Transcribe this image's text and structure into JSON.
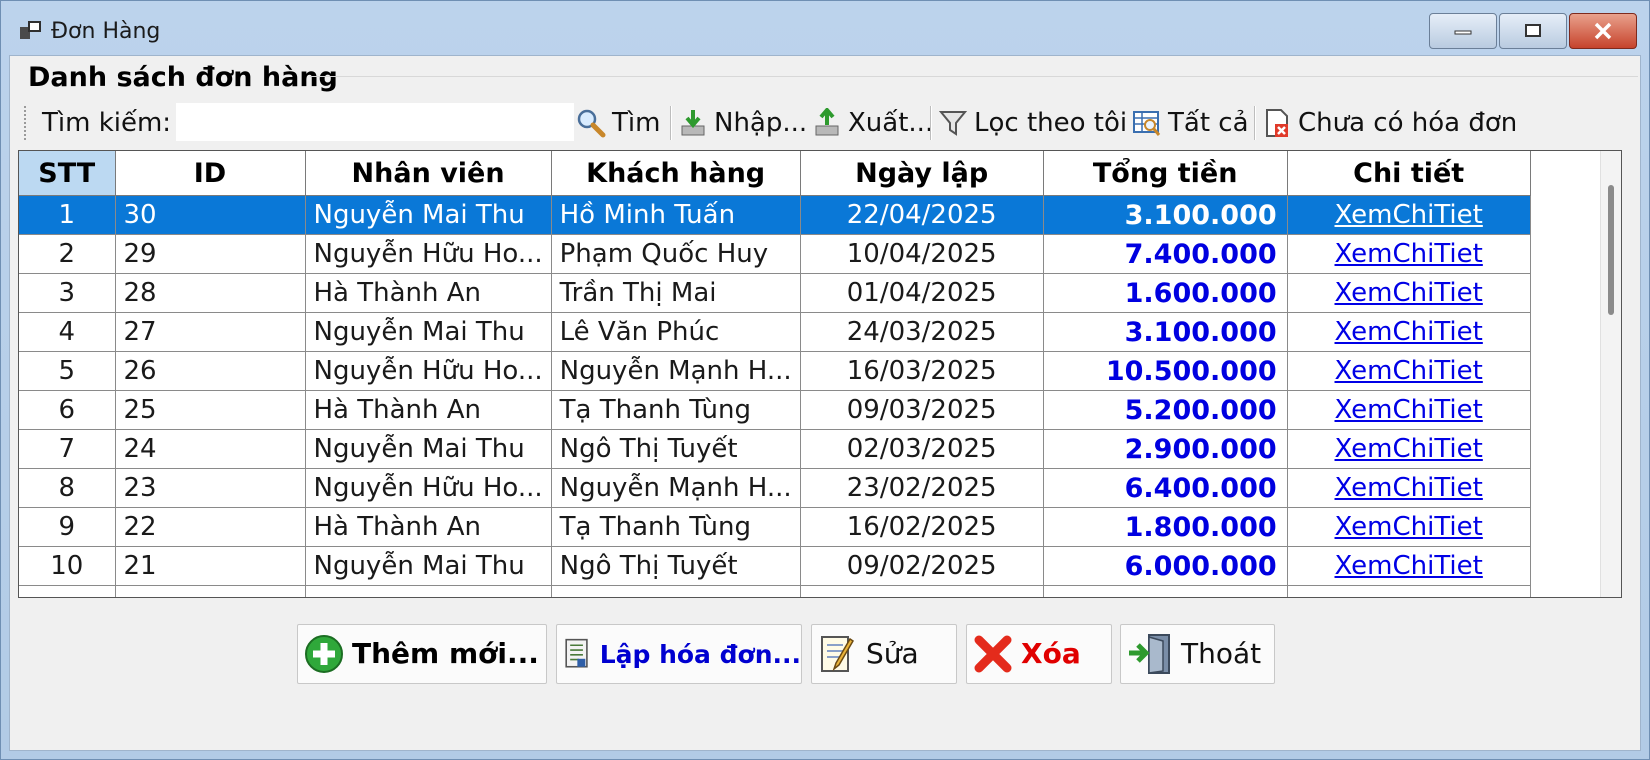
{
  "window": {
    "title": "Đơn Hàng",
    "icons": {
      "app": "app-windows-icon",
      "min": "minimize-icon",
      "max": "maximize-icon",
      "close": "close-icon"
    },
    "colors": {
      "selection": "#0a78d7",
      "total_text": "#0000e0",
      "link": "#0000e6",
      "delete_text": "#e00000"
    }
  },
  "section_title": "Danh sách đơn hàng",
  "toolbar": {
    "search_label": "Tìm kiếm:",
    "search_value": "",
    "buttons": {
      "find": "Tìm",
      "import": "Nhập...",
      "export": "Xuất...",
      "filter_mine": "Lọc theo tôi",
      "all": "Tất cả",
      "no_invoice": "Chưa có hóa đơn"
    }
  },
  "grid": {
    "columns": [
      "STT",
      "ID",
      "Nhân viên",
      "Khách hàng",
      "Ngày lập",
      "Tổng tiền",
      "Chi tiết"
    ],
    "selected_row": 0,
    "rows": [
      {
        "stt": "1",
        "id": "30",
        "staff": "Nguyễn Mai Thu",
        "customer": "Hồ Minh Tuấn",
        "date": "22/04/2025",
        "total": "3.100.000",
        "detail": "XemChiTiet"
      },
      {
        "stt": "2",
        "id": "29",
        "staff": "Nguyễn Hữu Ho...",
        "customer": "Phạm Quốc Huy",
        "date": "10/04/2025",
        "total": "7.400.000",
        "detail": "XemChiTiet"
      },
      {
        "stt": "3",
        "id": "28",
        "staff": "Hà Thành An",
        "customer": "Trần Thị Mai",
        "date": "01/04/2025",
        "total": "1.600.000",
        "detail": "XemChiTiet"
      },
      {
        "stt": "4",
        "id": "27",
        "staff": "Nguyễn Mai Thu",
        "customer": "Lê Văn Phúc",
        "date": "24/03/2025",
        "total": "3.100.000",
        "detail": "XemChiTiet"
      },
      {
        "stt": "5",
        "id": "26",
        "staff": "Nguyễn Hữu Ho...",
        "customer": "Nguyễn Mạnh H...",
        "date": "16/03/2025",
        "total": "10.500.000",
        "detail": "XemChiTiet"
      },
      {
        "stt": "6",
        "id": "25",
        "staff": "Hà Thành An",
        "customer": "Tạ Thanh Tùng",
        "date": "09/03/2025",
        "total": "5.200.000",
        "detail": "XemChiTiet"
      },
      {
        "stt": "7",
        "id": "24",
        "staff": "Nguyễn Mai Thu",
        "customer": "Ngô Thị Tuyết",
        "date": "02/03/2025",
        "total": "2.900.000",
        "detail": "XemChiTiet"
      },
      {
        "stt": "8",
        "id": "23",
        "staff": "Nguyễn Hữu Ho...",
        "customer": "Nguyễn Mạnh H...",
        "date": "23/02/2025",
        "total": "6.400.000",
        "detail": "XemChiTiet"
      },
      {
        "stt": "9",
        "id": "22",
        "staff": "Hà Thành An",
        "customer": "Tạ Thanh Tùng",
        "date": "16/02/2025",
        "total": "1.800.000",
        "detail": "XemChiTiet"
      },
      {
        "stt": "10",
        "id": "21",
        "staff": "Nguyễn Mai Thu",
        "customer": "Ngô Thị Tuyết",
        "date": "09/02/2025",
        "total": "6.000.000",
        "detail": "XemChiTiet"
      }
    ]
  },
  "actions": {
    "add": "Thêm mới...",
    "invoice": "Lập hóa đơn...",
    "edit": "Sửa",
    "delete": "Xóa",
    "exit": "Thoát"
  }
}
